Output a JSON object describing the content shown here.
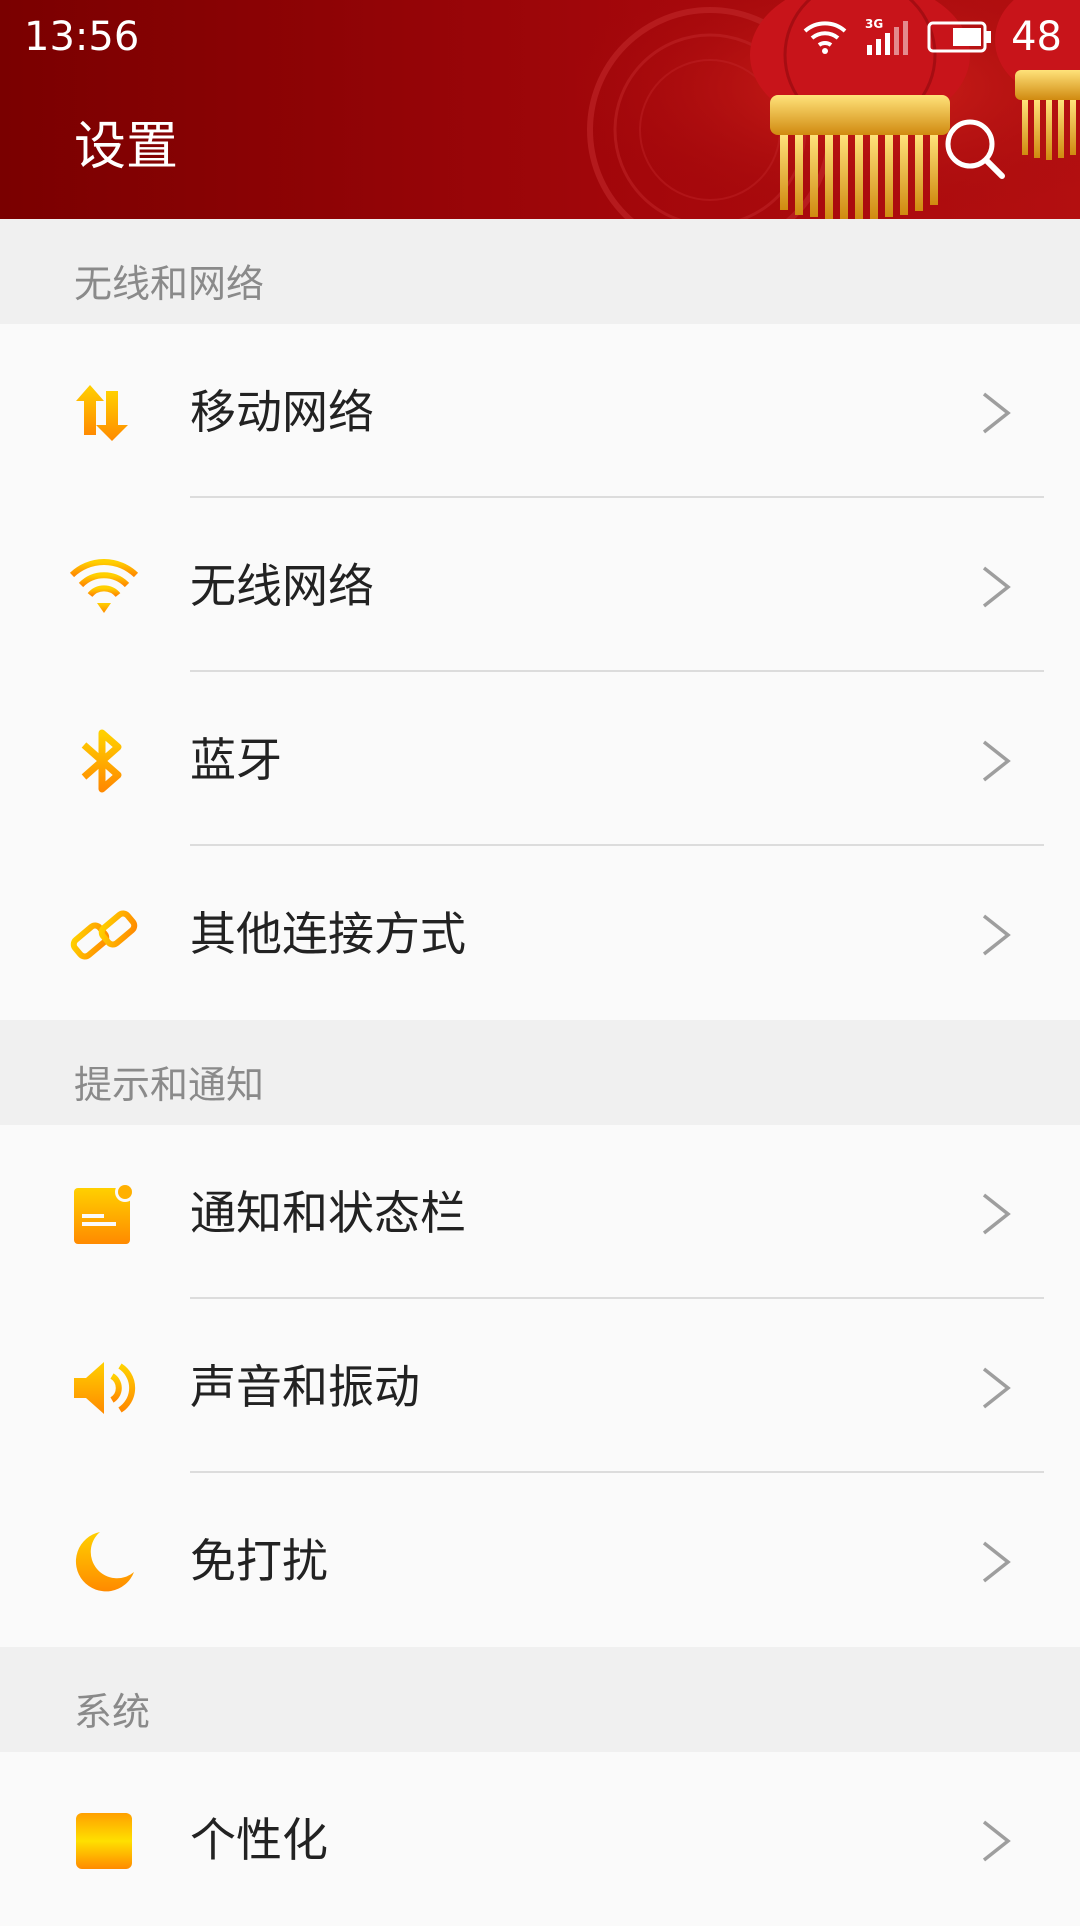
{
  "status_bar": {
    "time": "13:56",
    "battery": "48",
    "network_type": "3G",
    "icons": [
      "wifi-icon",
      "signal-3g-icon",
      "battery-icon"
    ]
  },
  "header": {
    "title": "设置",
    "search_icon": "search-icon",
    "background_color": "#8e0305"
  },
  "accent_color": "#ffb000",
  "sections": [
    {
      "title": "无线和网络",
      "items": [
        {
          "label": "移动网络",
          "icon": "mobile-data-icon"
        },
        {
          "label": "无线网络",
          "icon": "wifi-icon"
        },
        {
          "label": "蓝牙",
          "icon": "bluetooth-icon"
        },
        {
          "label": "其他连接方式",
          "icon": "link-icon"
        }
      ]
    },
    {
      "title": "提示和通知",
      "items": [
        {
          "label": "通知和状态栏",
          "icon": "notification-icon"
        },
        {
          "label": "声音和振动",
          "icon": "sound-icon"
        },
        {
          "label": "免打扰",
          "icon": "moon-icon"
        }
      ]
    },
    {
      "title": "系统",
      "items": [
        {
          "label": "个性化",
          "icon": "personalize-icon"
        }
      ]
    }
  ]
}
